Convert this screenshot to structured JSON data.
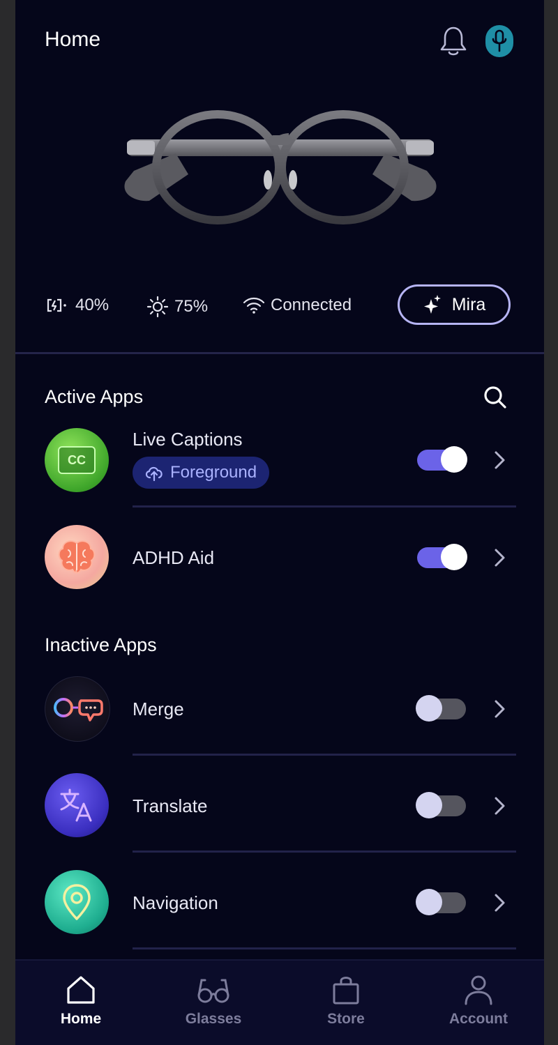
{
  "header": {
    "title": "Home",
    "notification_icon": "bell-icon",
    "mic_icon": "microphone-icon",
    "mic_color": "#1f8fa6"
  },
  "device": {
    "image": "smart-glasses",
    "battery": "40%",
    "brightness": "75%",
    "connection": "Connected",
    "assistant_label": "Mira"
  },
  "active_apps": {
    "title": "Active Apps",
    "items": [
      {
        "name": "Live Captions",
        "badge": "Foreground",
        "enabled": true,
        "icon": "cc-icon"
      },
      {
        "name": "ADHD Aid",
        "enabled": true,
        "icon": "brain-icon"
      }
    ]
  },
  "inactive_apps": {
    "title": "Inactive Apps",
    "items": [
      {
        "name": "Merge",
        "enabled": false,
        "icon": "merge-icon"
      },
      {
        "name": "Translate",
        "enabled": false,
        "icon": "translate-icon"
      },
      {
        "name": "Navigation",
        "enabled": false,
        "icon": "location-pin-icon"
      }
    ]
  },
  "nav": {
    "items": [
      {
        "label": "Home",
        "icon": "home-icon",
        "active": true
      },
      {
        "label": "Glasses",
        "icon": "glasses-icon",
        "active": false
      },
      {
        "label": "Store",
        "icon": "shopping-bag-icon",
        "active": false
      },
      {
        "label": "Account",
        "icon": "user-icon",
        "active": false
      }
    ]
  },
  "colors": {
    "background": "#05061a",
    "accent": "#6b63e8",
    "badge_bg": "#1c2472"
  }
}
